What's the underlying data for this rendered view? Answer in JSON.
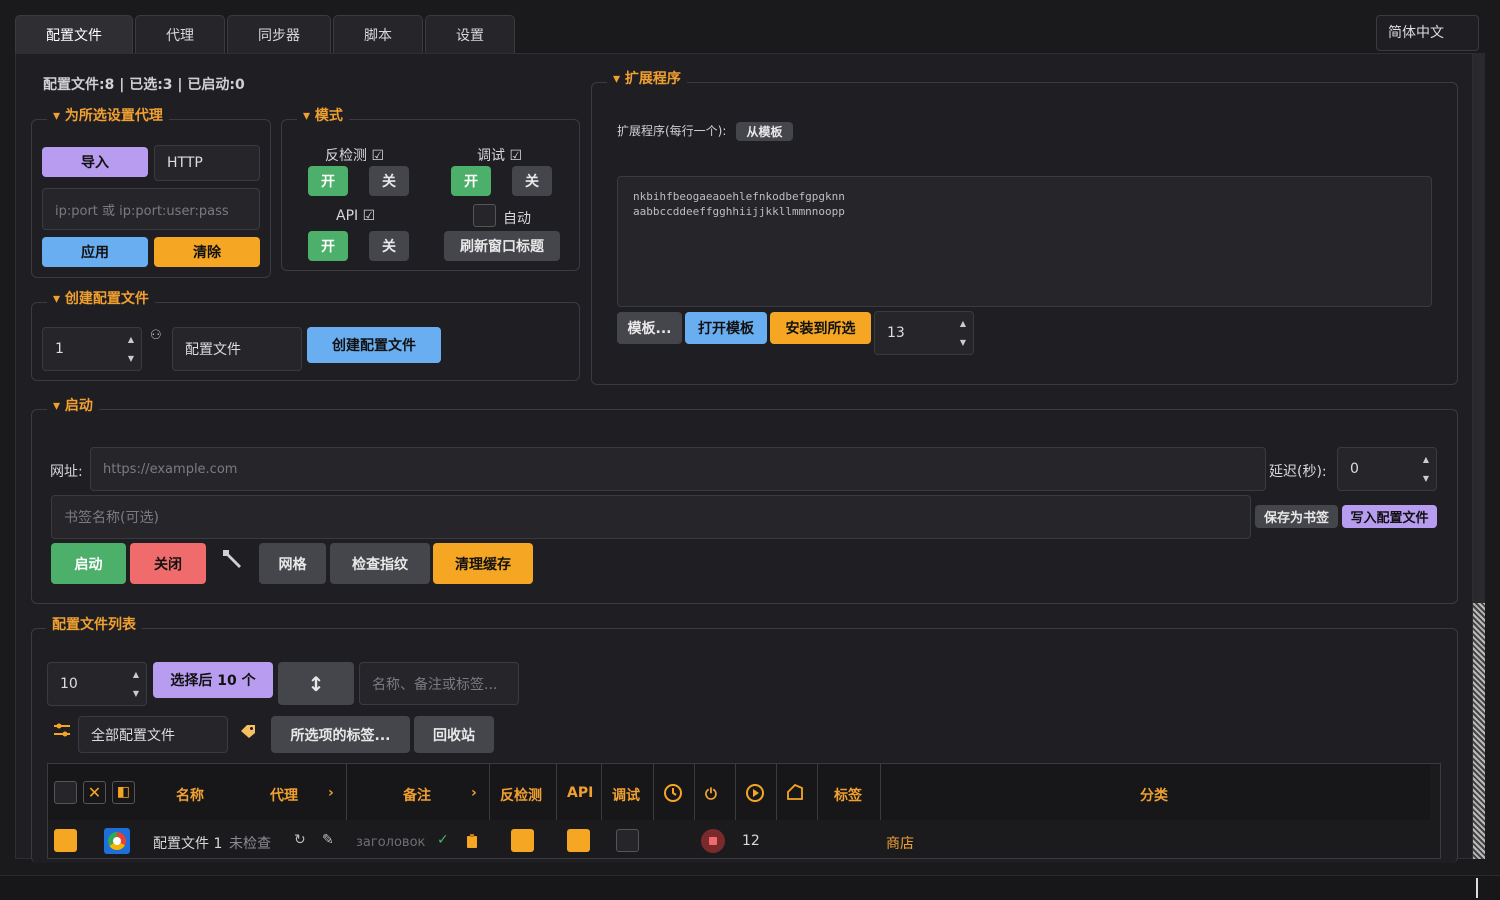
{
  "tabs": [
    "配置文件",
    "代理",
    "同步器",
    "脚本",
    "设置"
  ],
  "language": "简体中文",
  "summary": "配置文件:8 | 已选:3 | 已启动:0",
  "proxy": {
    "title": "为所选设置代理",
    "import": "导入",
    "type": "HTTP",
    "placeholder": "ip:port 或 ip:port:user:pass",
    "apply": "应用",
    "clear": "清除"
  },
  "mode": {
    "title": "模式",
    "antidetect": "反检测",
    "debug": "调试",
    "api": "API",
    "on": "开",
    "off": "关",
    "auto": "自动",
    "refresh": "刷新窗口标题",
    "check_mark": "☑"
  },
  "create": {
    "title": "创建配置文件",
    "count": "1",
    "name": "配置文件",
    "button": "创建配置文件"
  },
  "ext": {
    "title": "扩展程序",
    "label": "扩展程序(每行一个):",
    "from_template": "从模板",
    "line1": "nkbihfbeogaeaoehlefnkodbefgpgknn",
    "line2": "aabbccddeeffgghhiijjkkllmmnnoopp",
    "templates": "模板...",
    "open_template": "打开模板",
    "install": "安装到所选",
    "number": "13"
  },
  "launch": {
    "title": "启动",
    "url_label": "网址:",
    "url_placeholder": "https://example.com",
    "delay_label": "延迟(秒):",
    "delay": "0",
    "bookmark_placeholder": "书签名称(可选)",
    "save_bookmark": "保存为书签",
    "write_profile": "写入配置文件",
    "start": "启动",
    "close": "关闭",
    "grid": "网格",
    "check_fp": "检查指纹",
    "clear_cache": "清理缓存"
  },
  "list": {
    "title": "配置文件列表",
    "count": "10",
    "select_next": "选择后 10 个",
    "sort_icon": "↕",
    "search_placeholder": "名称、备注或标签...",
    "filter": "全部配置文件",
    "selected_tags": "所选项的标签...",
    "recycle": "回收站",
    "headers": {
      "name": "名称",
      "proxy": "代理",
      "note": "备注",
      "antidetect": "反检测",
      "api": "API",
      "debug": "调试",
      "tags": "标签",
      "category": "分类"
    },
    "row": {
      "name": "配置文件 1",
      "proxy": "未检查",
      "note": "заголовок",
      "count": "12",
      "category": "商店"
    }
  }
}
